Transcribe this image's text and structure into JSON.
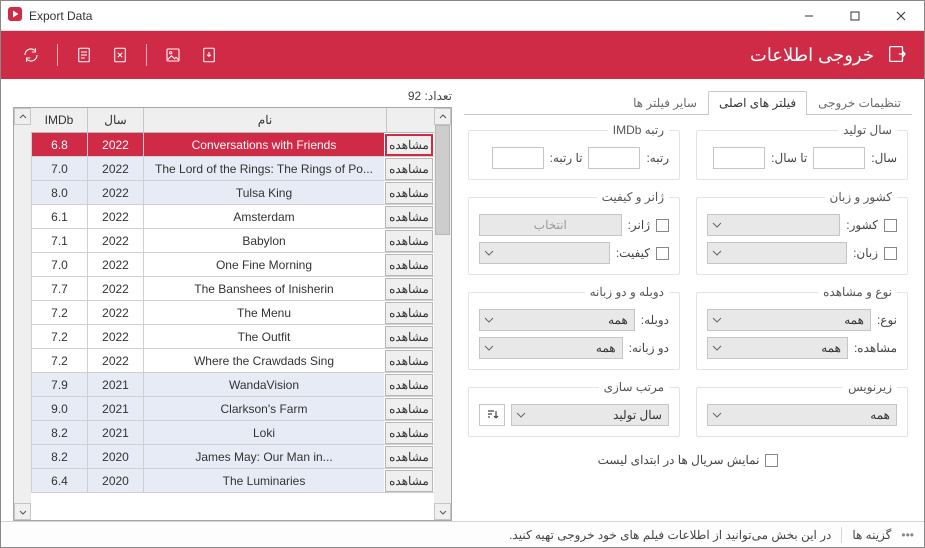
{
  "window": {
    "title": "Export Data"
  },
  "header": {
    "title": "خروجی اطلاعات"
  },
  "tabs": {
    "export_settings": "تنظیمات خروجی",
    "main_filters": "فیلتر های اصلی",
    "other_filters": "سایر فیلتر ها"
  },
  "groups": {
    "year": {
      "legend": "سال تولید",
      "year_label": "سال:",
      "to_year_label": "تا سال:"
    },
    "imdb": {
      "legend": "رتبه IMDb",
      "rank_label": "رتبه:",
      "to_rank_label": "تا رتبه:"
    },
    "country_lang": {
      "legend": "کشور و زبان",
      "country_label": "کشور:",
      "lang_label": "زبان:"
    },
    "genre_quality": {
      "legend": "ژانر و کیفیت",
      "genre_label": "ژانر:",
      "genre_button": "انتخاب",
      "quality_label": "کیفیت:"
    },
    "type_view": {
      "legend": "نوع و مشاهده",
      "type_label": "نوع:",
      "view_label": "مشاهده:",
      "all": "همه"
    },
    "dub_bilang": {
      "legend": "دوبله و دو زبانه",
      "dub_label": "دوبله:",
      "bilang_label": "دو زبانه:",
      "all": "همه"
    },
    "subtitle": {
      "legend": "زیرنویس",
      "all": "همه"
    },
    "sort": {
      "legend": "مرتب سازی",
      "value": "سال تولید"
    }
  },
  "serials_checkbox": "نمایش سریال ها در ابتدای لیست",
  "grid": {
    "count_label": "تعداد: 92",
    "headers": {
      "imdb": "IMDb",
      "year": "سال",
      "name": "نام",
      "view": ""
    },
    "view_button": "مشاهده",
    "rows": [
      {
        "imdb": "6.8",
        "year": "2022",
        "name": "Conversations with Friends",
        "selected": true,
        "alt": false
      },
      {
        "imdb": "7.0",
        "year": "2022",
        "name": "The Lord of the Rings: The Rings of Po...",
        "alt": true
      },
      {
        "imdb": "8.0",
        "year": "2022",
        "name": "Tulsa King",
        "alt": true
      },
      {
        "imdb": "6.1",
        "year": "2022",
        "name": "Amsterdam",
        "alt": false
      },
      {
        "imdb": "7.1",
        "year": "2022",
        "name": "Babylon",
        "alt": false
      },
      {
        "imdb": "7.0",
        "year": "2022",
        "name": "One Fine Morning",
        "alt": false
      },
      {
        "imdb": "7.7",
        "year": "2022",
        "name": "The Banshees of Inisherin",
        "alt": false
      },
      {
        "imdb": "7.2",
        "year": "2022",
        "name": "The Menu",
        "alt": false
      },
      {
        "imdb": "7.2",
        "year": "2022",
        "name": "The Outfit",
        "alt": false
      },
      {
        "imdb": "7.2",
        "year": "2022",
        "name": "Where the Crawdads Sing",
        "alt": false
      },
      {
        "imdb": "7.9",
        "year": "2021",
        "name": "WandaVision",
        "alt": true
      },
      {
        "imdb": "9.0",
        "year": "2021",
        "name": "Clarkson's Farm",
        "alt": true
      },
      {
        "imdb": "8.2",
        "year": "2021",
        "name": "Loki",
        "alt": true
      },
      {
        "imdb": "8.2",
        "year": "2020",
        "name": "James May: Our Man in...",
        "alt": true
      },
      {
        "imdb": "6.4",
        "year": "2020",
        "name": "The Luminaries",
        "alt": true
      }
    ]
  },
  "statusbar": {
    "options": "گزینه ها",
    "hint": "در این بخش می‌توانید از اطلاعات فیلم های خود خروجی تهیه کنید."
  }
}
